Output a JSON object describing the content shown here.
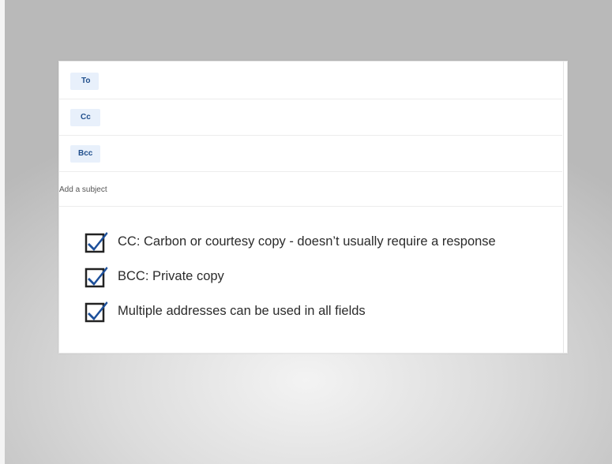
{
  "compose": {
    "to_label": "To",
    "cc_label": "Cc",
    "bcc_label": "Bcc",
    "subject_placeholder": "Add a subject"
  },
  "bullets": [
    {
      "text": "CC: Carbon or courtesy copy - doesn’t usually require a response",
      "icon": "checkbox-checked-icon"
    },
    {
      "text": "BCC: Private copy",
      "icon": "checkbox-checked-icon"
    },
    {
      "text": "Multiple addresses can be used in all fields",
      "icon": "checkbox-checked-icon"
    }
  ],
  "colors": {
    "chip_bg": "#e8f0fb",
    "chip_text": "#1f4e8c",
    "check": "#1c4f9a",
    "box_border": "#222222"
  }
}
